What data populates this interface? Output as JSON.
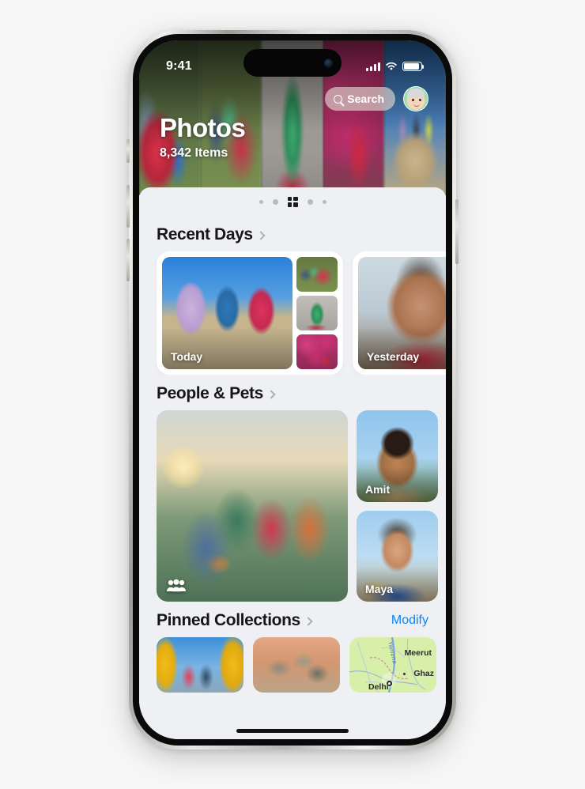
{
  "status_bar": {
    "time": "9:41",
    "cellular_icon": "signal-bars-icon",
    "wifi_icon": "wifi-icon",
    "battery_icon": "battery-icon"
  },
  "header": {
    "title": "Photos",
    "subtitle": "8,342 Items",
    "search_label": "Search",
    "search_icon": "search-icon",
    "avatar_icon": "memoji-avatar"
  },
  "pager": {
    "grid_icon": "grid-view-icon",
    "dots": [
      "small",
      "medium",
      "active-grid",
      "medium",
      "small"
    ]
  },
  "sections": {
    "recent_days": {
      "title": "Recent Days",
      "chevron_icon": "chevron-right-icon",
      "cards": [
        {
          "label": "Today"
        },
        {
          "label": "Yesterday"
        }
      ]
    },
    "people_pets": {
      "title": "People & Pets",
      "chevron_icon": "chevron-right-icon",
      "group_icon": "group-people-icon",
      "faces": [
        {
          "name": "Amit"
        },
        {
          "name": "Maya"
        }
      ]
    },
    "pinned_collections": {
      "title": "Pinned Collections",
      "chevron_icon": "chevron-right-icon",
      "modify_label": "Modify",
      "map": {
        "labels": [
          "Meerut",
          "Ghaz",
          "Delhi"
        ],
        "river_label": "Yamuna"
      }
    }
  },
  "colors": {
    "accent": "#0a84ff",
    "background": "#f6f6f7",
    "sheet": "#eff0f4",
    "text": "#16161a"
  }
}
